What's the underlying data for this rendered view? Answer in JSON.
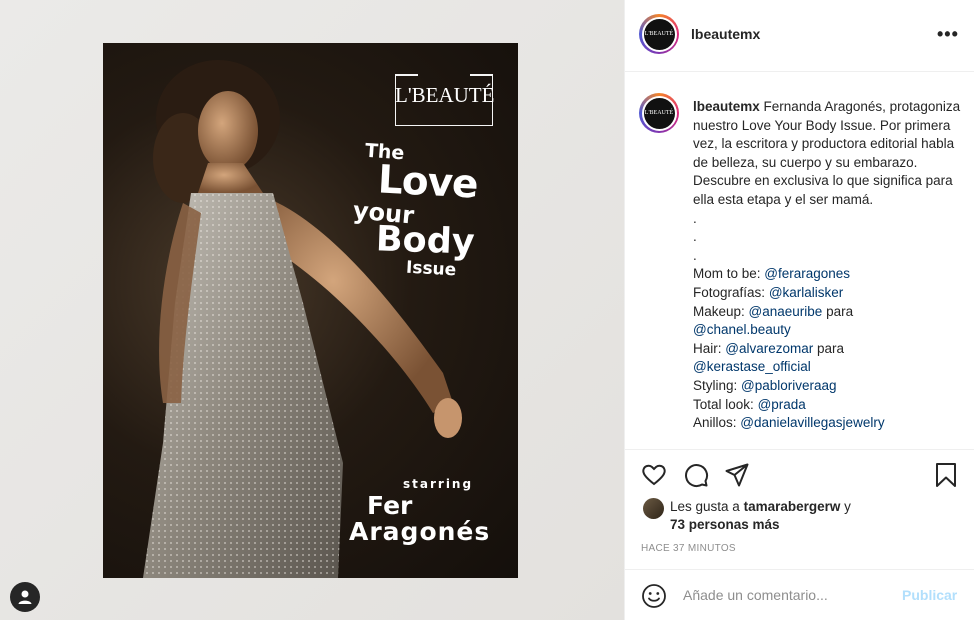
{
  "post": {
    "cover": {
      "logo": "L'BEAUTÉ",
      "title_the": "The",
      "title_love": "Love",
      "title_your": "your",
      "title_body": "Body",
      "title_issue": "Issue",
      "starring": "starring",
      "name_first": "Fer",
      "name_last": "Aragonés"
    }
  },
  "header": {
    "username": "lbeautemx",
    "avatar_text": "L'BEAUTÉ",
    "more_label": "•••"
  },
  "caption": {
    "username": "lbeautemx",
    "intro": "Fernanda Aragonés, protagoniza nuestro Love Your Body Issue. Por primera vez, la escritora y productora editorial habla de belleza, su cuerpo y su embarazo.",
    "line2": "Descubre en exclusiva lo que significa para ella esta etapa y el ser mamá.",
    "dot1": ".",
    "dot2": ".",
    "dot3": ".",
    "credits": [
      {
        "label": "Mom to be:",
        "mention": "@feraragones",
        "suffix": ""
      },
      {
        "label": "Fotografías:",
        "mention": "@karlalisker",
        "suffix": ""
      },
      {
        "label": "Makeup:",
        "mention": "@anaeuribe",
        "suffix": " para"
      },
      {
        "label": "",
        "mention": "@chanel.beauty",
        "suffix": ""
      },
      {
        "label": "Hair:",
        "mention": "@alvarezomar",
        "suffix": " para"
      },
      {
        "label": "",
        "mention": "@kerastase_official",
        "suffix": ""
      },
      {
        "label": "Styling:",
        "mention": "@pabloriveraag",
        "suffix": ""
      },
      {
        "label": "Total look:",
        "mention": "@prada",
        "suffix": ""
      },
      {
        "label": "Anillos:",
        "mention": "@danielavillegasjewelry",
        "suffix": ""
      }
    ]
  },
  "likes": {
    "prefix": "Les gusta a",
    "user": "tamarabergerw",
    "conj": "y",
    "others": "73 personas más"
  },
  "timestamp": "HACE 37 MINUTOS",
  "comment": {
    "placeholder": "Añade un comentario...",
    "publish": "Publicar"
  },
  "icons": {
    "like": "heart-icon",
    "comment": "comment-icon",
    "share": "paper-plane-icon",
    "save": "bookmark-icon",
    "emoji": "emoji-smile-icon",
    "profile": "user-icon"
  },
  "colors": {
    "mention": "#00376b",
    "publish_disabled": "#b2dffc",
    "meta_gray": "#8e8e8e",
    "text": "#262626"
  }
}
